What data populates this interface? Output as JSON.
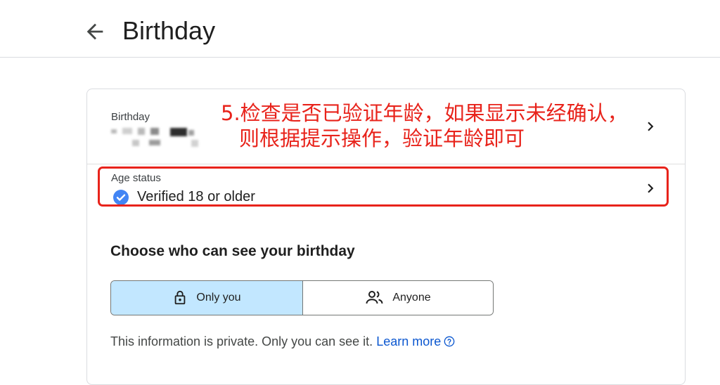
{
  "header": {
    "title": "Birthday",
    "back_icon": "arrow-left-icon"
  },
  "birthday_row": {
    "label": "Birthday",
    "value_redacted": true
  },
  "age_status": {
    "label": "Age status",
    "value": "Verified 18 or older",
    "status_icon": "verified-check-icon",
    "status_color": "#4285f4"
  },
  "annotation": {
    "line1": "5.检查是否已验证年龄，如果显示未经确认，",
    "line2": "则根据提示操作，验证年龄即可",
    "color": "#e8231b"
  },
  "visibility": {
    "title": "Choose who can see your birthday",
    "options": [
      {
        "label": "Only you",
        "icon": "lock-icon",
        "selected": true
      },
      {
        "label": "Anyone",
        "icon": "people-icon",
        "selected": false
      }
    ],
    "selected_color": "#c2e7ff"
  },
  "info": {
    "text": "This information is private. Only you can see it.",
    "link": "Learn more",
    "link_color": "#0b57d0"
  }
}
